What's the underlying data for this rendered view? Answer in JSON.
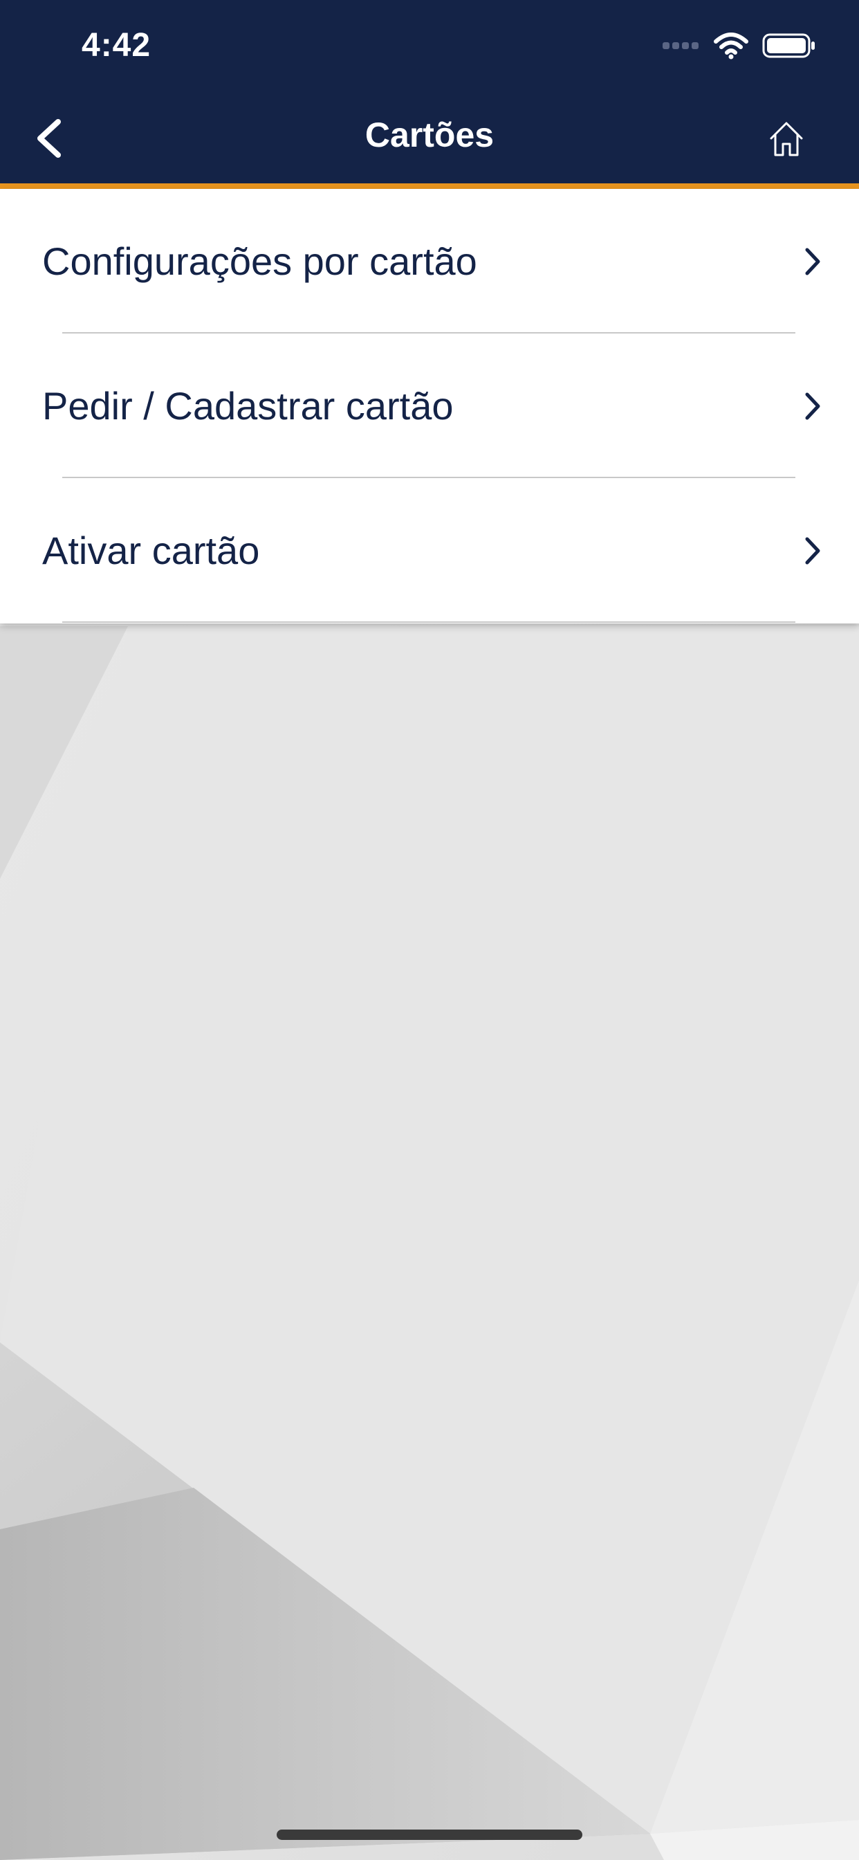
{
  "status_bar": {
    "time": "4:42"
  },
  "nav": {
    "title": "Cartões",
    "back_icon": "chevron-left-icon",
    "home_icon": "home-icon"
  },
  "menu": {
    "items": [
      {
        "label": "Configurações por cartão"
      },
      {
        "label": "Pedir / Cadastrar cartão"
      },
      {
        "label": "Ativar cartão"
      }
    ]
  },
  "colors": {
    "nav_background": "#142347",
    "nav_accent_line": "#e8941f",
    "menu_text": "#142347",
    "menu_background": "#ffffff"
  }
}
